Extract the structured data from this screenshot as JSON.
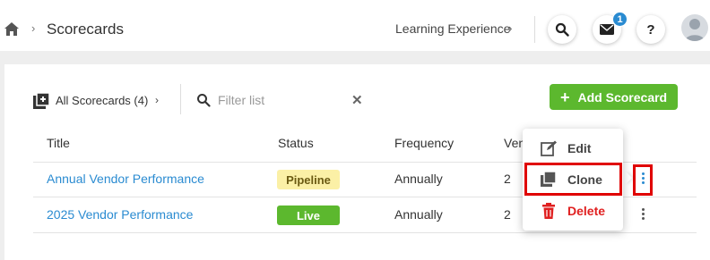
{
  "header": {
    "breadcrumb_sep": "›",
    "title": "Scorecards",
    "learning_label": "Learning Experience",
    "learning_chevron": "›",
    "notifications_badge": "1",
    "help_label": "?"
  },
  "toolbar": {
    "all_scorecards_label": "All Scorecards (4)",
    "all_scorecards_chevron": "›",
    "filter_placeholder": "Filter list",
    "clear_label": "✕",
    "add_button_plus": "+",
    "add_button_label": "Add Scorecard"
  },
  "table": {
    "columns": [
      "Title",
      "Status",
      "Frequency",
      "Ven"
    ],
    "rows": [
      {
        "title": "Annual Vendor Performance",
        "status": "Pipeline",
        "frequency": "Annually",
        "vendors": "2"
      },
      {
        "title": "2025 Vendor Performance",
        "status": "Live",
        "frequency": "Annually",
        "vendors": "2"
      }
    ]
  },
  "row_menu": {
    "items": [
      {
        "label": "Edit",
        "icon": "edit-icon"
      },
      {
        "label": "Clone",
        "icon": "clone-icon"
      },
      {
        "label": "Delete",
        "icon": "trash-icon"
      }
    ]
  },
  "colors": {
    "accent_green": "#5cb82e",
    "link_blue": "#2a8bd1",
    "pipeline_bg": "#fbf0a6",
    "delete_red": "#e02020",
    "highlight_red": "#e00000"
  }
}
